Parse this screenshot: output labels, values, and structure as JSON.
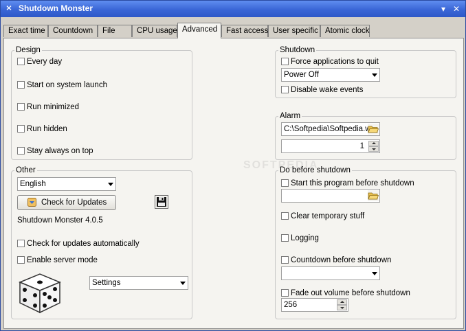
{
  "window": {
    "title": "Shutdown Monster"
  },
  "tabs": [
    {
      "label": "Exact time"
    },
    {
      "label": "Countdown"
    },
    {
      "label": "File"
    },
    {
      "label": "CPU usage"
    },
    {
      "label": "Advanced"
    },
    {
      "label": "Fast access"
    },
    {
      "label": "User specific"
    },
    {
      "label": "Atomic clock"
    }
  ],
  "design": {
    "label": "Design",
    "options": [
      {
        "label": "Every day"
      },
      {
        "label": "Start on system launch"
      },
      {
        "label": "Run minimized"
      },
      {
        "label": "Run hidden"
      },
      {
        "label": "Stay always on top"
      }
    ]
  },
  "other": {
    "label": "Other",
    "language": "English",
    "check_updates_button": "Check for Updates",
    "version": "Shutdown Monster 4.0.5",
    "check_auto": "Check for updates automatically",
    "server_mode": "Enable server mode",
    "settings_combo": "Settings"
  },
  "shutdown": {
    "label": "Shutdown",
    "force_quit": "Force applications to quit",
    "mode": "Power Off",
    "disable_wake": "Disable wake events"
  },
  "alarm": {
    "label": "Alarm",
    "path": "C:\\Softpedia\\Softpedia.w",
    "count": "1"
  },
  "before": {
    "label": "Do before shutdown",
    "start_program": "Start this program before shutdown",
    "program_path": "",
    "clear_temp": "Clear temporary stuff",
    "logging": "Logging",
    "countdown": "Countdown before shutdown",
    "countdown_value": "",
    "fade_volume": "Fade out volume before shutdown",
    "volume": "256"
  },
  "watermark": "SOFTPEDIA"
}
